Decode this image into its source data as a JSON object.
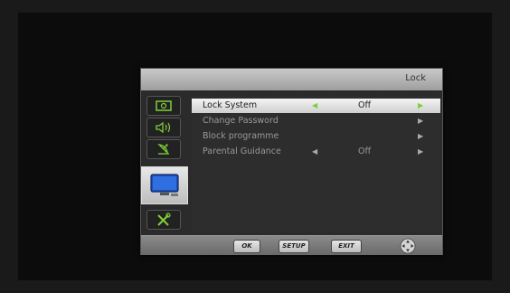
{
  "menu": {
    "title": "Lock",
    "tabs": [
      {
        "name": "picture",
        "icon": "picture-icon"
      },
      {
        "name": "sound",
        "icon": "sound-icon"
      },
      {
        "name": "channel",
        "icon": "satellite-dish-icon"
      },
      {
        "name": "lock",
        "icon": "tv-lock-icon",
        "selected": true
      },
      {
        "name": "setup",
        "icon": "tools-icon"
      }
    ],
    "items": [
      {
        "label": "Lock System",
        "value": "Off",
        "has_left": true,
        "highlighted": true
      },
      {
        "label": "Change Password",
        "value": "",
        "has_left": false,
        "highlighted": false
      },
      {
        "label": "Block programme",
        "value": "",
        "has_left": false,
        "highlighted": false
      },
      {
        "label": "Parental Guidance",
        "value": "Off",
        "has_left": true,
        "highlighted": false
      }
    ],
    "footer": {
      "ok_label": "OK",
      "setup_label": "SETUP",
      "exit_label": "EXIT"
    }
  },
  "colors": {
    "accent": "#7fcf3a",
    "highlight": "#e4e4e4",
    "panel": "#2b2b2b"
  }
}
